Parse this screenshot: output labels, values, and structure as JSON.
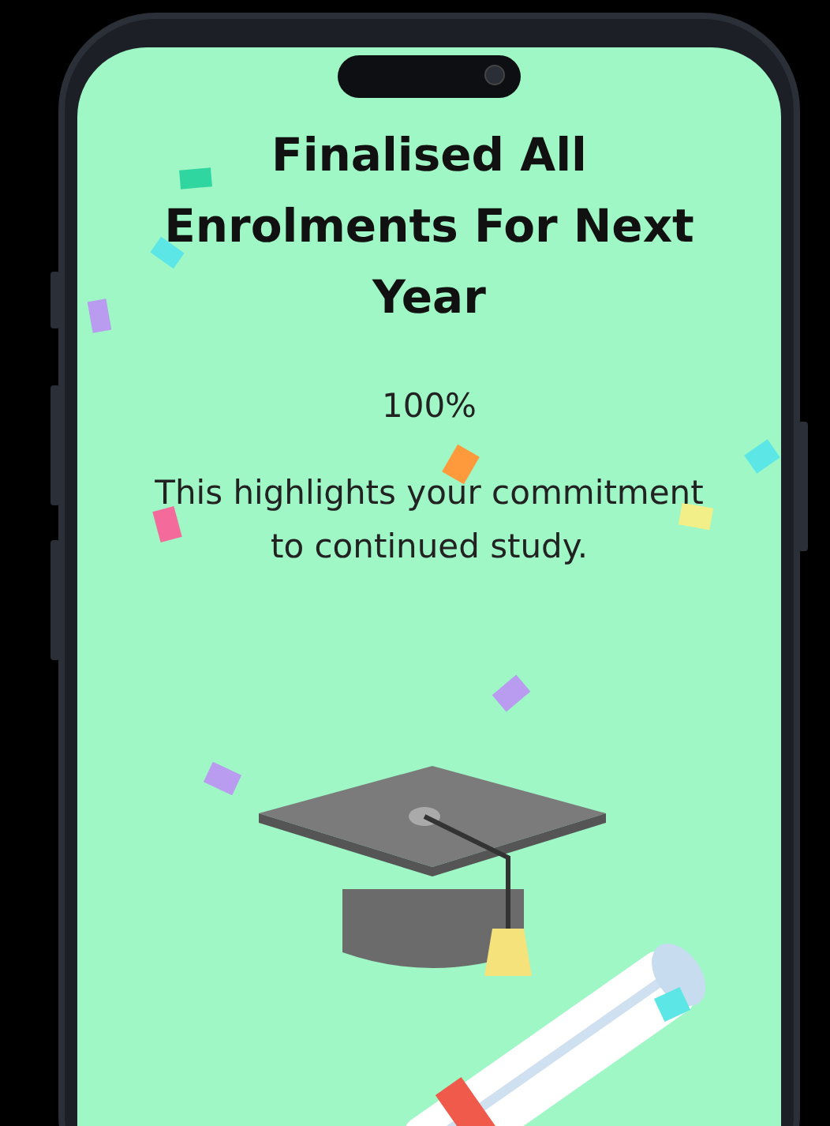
{
  "title": "Finalised All Enrolments For Next Year",
  "progress": "100%",
  "description": "This highlights your commitment to continued study."
}
